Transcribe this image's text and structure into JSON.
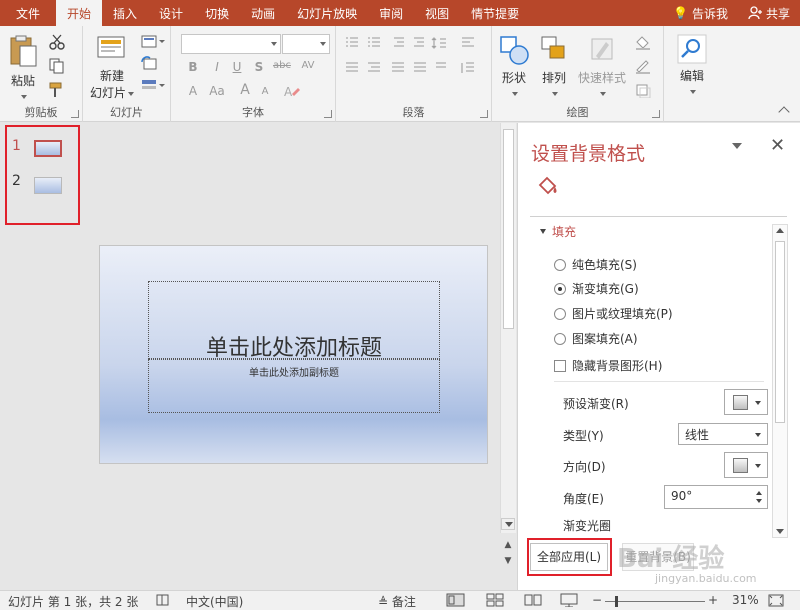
{
  "tabs": [
    "文件",
    "开始",
    "插入",
    "设计",
    "切换",
    "动画",
    "幻灯片放映",
    "审阅",
    "视图",
    "情节提要"
  ],
  "active_tab": "开始",
  "tell_me": "告诉我",
  "share": "共享",
  "ribbon": {
    "groups": {
      "clipboard": "剪贴板",
      "slides": "幻灯片",
      "font": "字体",
      "paragraph": "段落",
      "drawing": "绘图"
    },
    "paste": "粘贴",
    "new_slide": "新建\n幻灯片",
    "new_slide_line1": "新建",
    "new_slide_line2": "幻灯片",
    "shape": "形状",
    "arrange": "排列",
    "quick_styles": "快速样式",
    "edit": "编辑",
    "font_buttons": [
      "B",
      "I",
      "U",
      "S",
      "abc",
      "AV",
      "Aa",
      "A",
      "A",
      "A"
    ]
  },
  "thumbnails": [
    {
      "num": "1"
    },
    {
      "num": "2"
    }
  ],
  "slide": {
    "title_placeholder": "单击此处添加标题",
    "subtitle_placeholder": "单击此处添加副标题"
  },
  "format_pane": {
    "title": "设置背景格式",
    "section": "填充",
    "fill_options": [
      "纯色填充(S)",
      "渐变填充(G)",
      "图片或纹理填充(P)",
      "图案填充(A)"
    ],
    "selected_fill": "渐变填充(G)",
    "hide_bg_graphics": "隐藏背景图形(H)",
    "preset_gradient": "预设渐变(R)",
    "type_label": "类型(Y)",
    "type_value": "线性",
    "direction_label": "方向(D)",
    "angle_label": "角度(E)",
    "angle_value": "90°",
    "gradient_stops": "渐变光圈",
    "apply_all": "全部应用(L)",
    "reset": "重置背景(B)"
  },
  "status": {
    "slide_info": "幻灯片 第 1 张，共 2 张",
    "language": "中文(中国)",
    "notes": "备注",
    "zoom": "31%"
  },
  "watermark": {
    "text": "Bai 经验",
    "sub": "jingyan.baidu.com"
  },
  "colors": {
    "accent": "#b7472a",
    "pane_title": "#c0504d",
    "highlight": "#e0202a"
  }
}
